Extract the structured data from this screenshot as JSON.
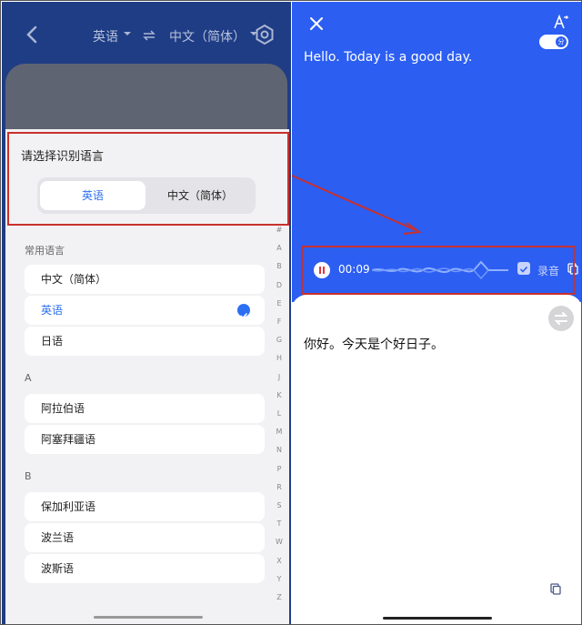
{
  "left": {
    "header": {
      "source_lang": "英语",
      "target_lang": "中文（简体）"
    },
    "sheet": {
      "prompt": "请选择识别语言",
      "segment_options": [
        "英语",
        "中文（简体）"
      ],
      "common_label": "常用语言",
      "common_items": [
        "中文（简体）",
        "英语",
        "日语"
      ],
      "section_a_label": "A",
      "section_a_items": [
        "阿拉伯语",
        "阿塞拜疆语"
      ],
      "section_b_label": "B",
      "section_b_items": [
        "保加利亚语",
        "波兰语",
        "波斯语"
      ],
      "index_letters": [
        "#",
        "A",
        "B",
        "D",
        "E",
        "F",
        "G",
        "H",
        "J",
        "K",
        "L",
        "M",
        "N",
        "P",
        "R",
        "S",
        "T",
        "W",
        "X",
        "Y",
        "Z"
      ]
    }
  },
  "right": {
    "source_text": "Hello. Today is a good day.",
    "toggle_label": "分",
    "recording": {
      "time": "00:09",
      "record_label": "录音"
    },
    "translated_text": "你好。今天是个好日子。"
  },
  "colors": {
    "accent_blue": "#2c5ef2",
    "highlight_red": "#c9302c"
  }
}
